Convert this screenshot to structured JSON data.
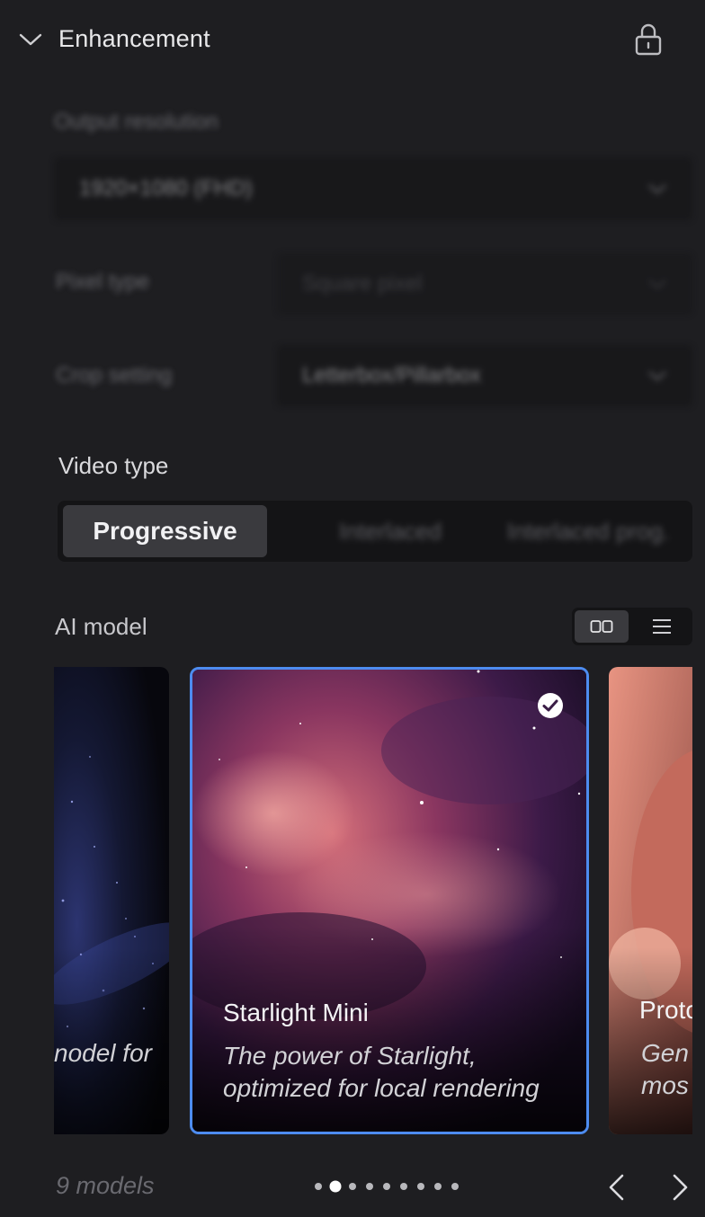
{
  "header": {
    "title": "Enhancement"
  },
  "output": {
    "label": "Output resolution",
    "value": "1920×1080 (FHD)"
  },
  "pixel": {
    "label": "Pixel type",
    "value": "Square pixel"
  },
  "crop": {
    "label": "Crop setting",
    "value": "Letterbox/Pillarbox"
  },
  "video_type": {
    "label": "Video type",
    "options": [
      "Progressive",
      "Interlaced",
      "Interlaced prog."
    ],
    "selected": "Progressive"
  },
  "ai_model": {
    "label": "AI model",
    "cards": [
      {
        "name": "",
        "desc_tail": "nodel for"
      },
      {
        "name": "Starlight Mini",
        "desc": "The power of Starlight, optimized for local rendering",
        "desc_line1": "The power of Starlight,",
        "desc_line2": "optimized for local rendering",
        "selected": true
      },
      {
        "name": "Proto",
        "desc_line1": "Gen",
        "desc_line2": "mos"
      }
    ],
    "count": "9 models",
    "page_count": 9,
    "current_page": 2
  },
  "colors": {
    "accent": "#4d8cf0",
    "background": "#1e1e21"
  }
}
